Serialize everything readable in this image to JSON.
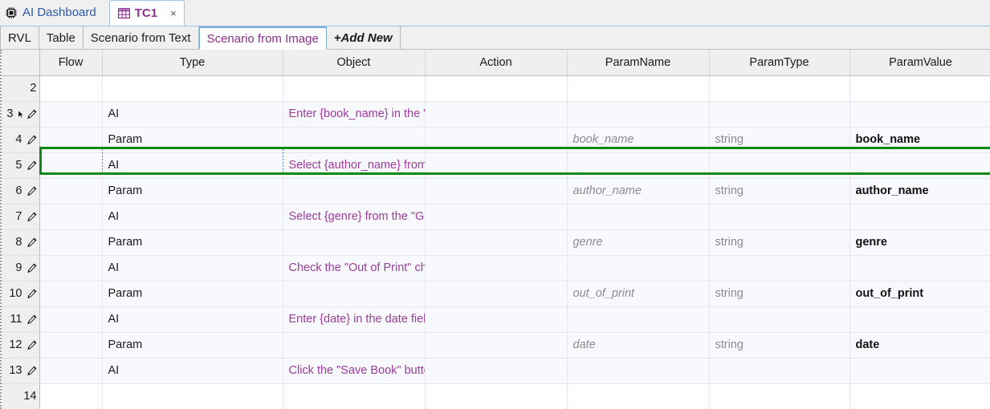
{
  "window": {
    "brand_label": "AI Dashboard",
    "brand_icon": "ai-chip-icon"
  },
  "document_tab": {
    "label": "TC1",
    "icon": "table-grid-icon",
    "close_label": "×"
  },
  "subtabs": [
    {
      "label": "RVL",
      "active": false
    },
    {
      "label": "Table",
      "active": false
    },
    {
      "label": "Scenario from Text",
      "active": false
    },
    {
      "label": "Scenario from Image",
      "active": true
    },
    {
      "label": "+Add New",
      "active": false
    }
  ],
  "grid": {
    "columns": [
      "Flow",
      "Type",
      "Object",
      "Action",
      "ParamName",
      "ParamType",
      "ParamValue"
    ],
    "selected_row_number": "3",
    "rows": [
      {
        "num": "2",
        "edit_icon": "",
        "cursor": false,
        "empty": true,
        "flow": "",
        "type": "",
        "object": "",
        "action": "",
        "param_name": "",
        "param_type": "",
        "param_value": ""
      },
      {
        "num": "3",
        "edit_icon": "pencil-icon",
        "cursor": true,
        "empty": false,
        "flow": "",
        "type": "AI",
        "object": "Enter {book_name} in the \"Name\" field.",
        "action": "",
        "param_name": "",
        "param_type": "",
        "param_value": ""
      },
      {
        "num": "4",
        "edit_icon": "pencil-icon",
        "cursor": false,
        "empty": false,
        "flow": "",
        "type": "Param",
        "object": "",
        "action": "",
        "param_name": "book_name",
        "param_type": "string",
        "param_value": "book_name"
      },
      {
        "num": "5",
        "edit_icon": "pencil-icon",
        "cursor": false,
        "empty": false,
        "flow": "",
        "type": "AI",
        "object": "Select {author_name} from the \"Author\" dropdown.",
        "action": "",
        "param_name": "",
        "param_type": "",
        "param_value": ""
      },
      {
        "num": "6",
        "edit_icon": "pencil-icon",
        "cursor": false,
        "empty": false,
        "flow": "",
        "type": "Param",
        "object": "",
        "action": "",
        "param_name": "author_name",
        "param_type": "string",
        "param_value": "author_name"
      },
      {
        "num": "7",
        "edit_icon": "pencil-icon",
        "cursor": false,
        "empty": false,
        "flow": "",
        "type": "AI",
        "object": "Select {genre} from the \"Genre\" dropdown.",
        "action": "",
        "param_name": "",
        "param_type": "",
        "param_value": ""
      },
      {
        "num": "8",
        "edit_icon": "pencil-icon",
        "cursor": false,
        "empty": false,
        "flow": "",
        "type": "Param",
        "object": "",
        "action": "",
        "param_name": "genre",
        "param_type": "string",
        "param_value": "genre"
      },
      {
        "num": "9",
        "edit_icon": "pencil-icon",
        "cursor": false,
        "empty": false,
        "flow": "",
        "type": "AI",
        "object": "Check the \"Out of Print\" checkbox if {out_of_print} is true.",
        "action": "",
        "param_name": "",
        "param_type": "",
        "param_value": ""
      },
      {
        "num": "10",
        "edit_icon": "pencil-icon",
        "cursor": false,
        "empty": false,
        "flow": "",
        "type": "Param",
        "object": "",
        "action": "",
        "param_name": "out_of_print",
        "param_type": "string",
        "param_value": "out_of_print"
      },
      {
        "num": "11",
        "edit_icon": "pencil-icon",
        "cursor": false,
        "empty": false,
        "flow": "",
        "type": "AI",
        "object": "Enter {date} in the date field.",
        "action": "",
        "param_name": "",
        "param_type": "",
        "param_value": ""
      },
      {
        "num": "12",
        "edit_icon": "pencil-icon",
        "cursor": false,
        "empty": false,
        "flow": "",
        "type": "Param",
        "object": "",
        "action": "",
        "param_name": "date",
        "param_type": "string",
        "param_value": "date"
      },
      {
        "num": "13",
        "edit_icon": "pencil-icon",
        "cursor": false,
        "empty": false,
        "flow": "",
        "type": "AI",
        "object": "Click the \"Save Book\" button.",
        "action": "",
        "param_name": "",
        "param_type": "",
        "param_value": ""
      },
      {
        "num": "14",
        "edit_icon": "",
        "cursor": false,
        "empty": true,
        "flow": "",
        "type": "",
        "object": "",
        "action": "",
        "param_name": "",
        "param_type": "",
        "param_value": ""
      }
    ]
  },
  "colors": {
    "accent_purple": "#9b3b9b",
    "brand_blue": "#2b5aa8",
    "selection_green": "#0d8a15",
    "tab_border_blue": "#9fc3e8"
  }
}
